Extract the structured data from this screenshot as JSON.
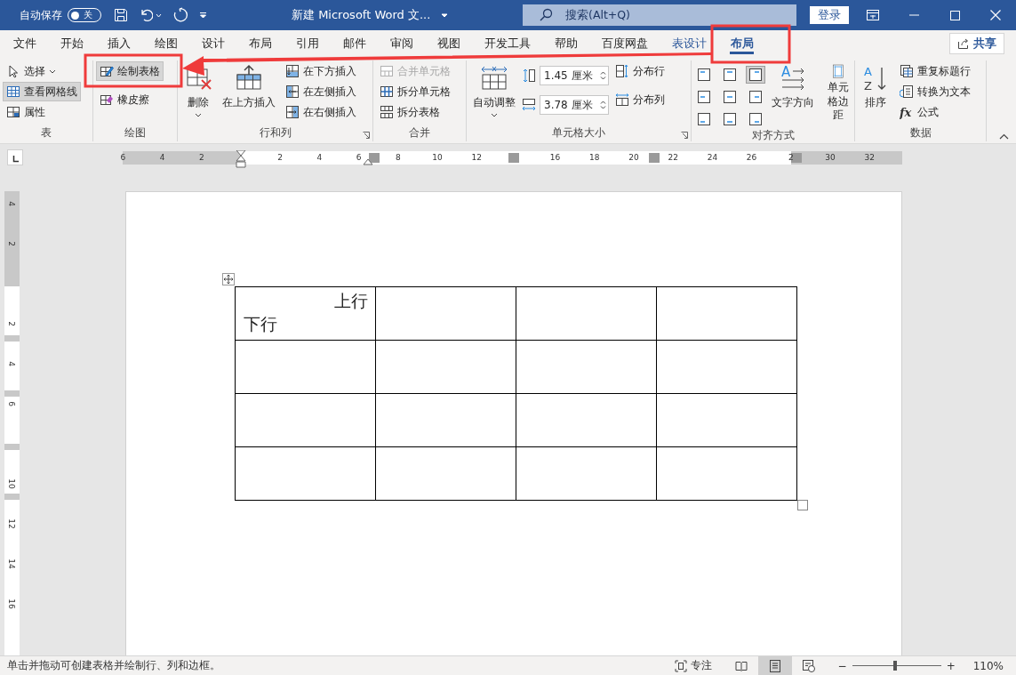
{
  "title_bar": {
    "autosave_label": "自动保存",
    "autosave": {
      "on": false,
      "label": "关"
    },
    "document_title": "新建 Microsoft Word 文...",
    "search": {
      "placeholder": "搜索(Alt+Q)"
    },
    "login": "登录"
  },
  "tabs": [
    {
      "label": "文件",
      "selected": false,
      "kind": "normal"
    },
    {
      "label": "开始",
      "selected": false,
      "kind": "normal"
    },
    {
      "label": "插入",
      "selected": false,
      "kind": "normal"
    },
    {
      "label": "绘图",
      "selected": false,
      "kind": "normal"
    },
    {
      "label": "设计",
      "selected": false,
      "kind": "normal"
    },
    {
      "label": "布局",
      "selected": false,
      "kind": "normal"
    },
    {
      "label": "引用",
      "selected": false,
      "kind": "normal"
    },
    {
      "label": "邮件",
      "selected": false,
      "kind": "normal"
    },
    {
      "label": "审阅",
      "selected": false,
      "kind": "normal"
    },
    {
      "label": "视图",
      "selected": false,
      "kind": "normal"
    },
    {
      "label": "开发工具",
      "selected": false,
      "kind": "normal"
    },
    {
      "label": "帮助",
      "selected": false,
      "kind": "normal"
    },
    {
      "label": "百度网盘",
      "selected": false,
      "kind": "normal"
    },
    {
      "label": "表设计",
      "selected": false,
      "kind": "contextual"
    },
    {
      "label": "布局",
      "selected": true,
      "kind": "contextual"
    }
  ],
  "share": "共享",
  "ribbon": [
    {
      "title": "表",
      "launcher": false,
      "columns": [
        [
          {
            "kind": "small",
            "label": "选择",
            "dropdown": true,
            "selected": false,
            "disabled": false
          },
          {
            "kind": "small",
            "label": "查看网格线",
            "dropdown": false,
            "selected": true,
            "disabled": false
          },
          {
            "kind": "small",
            "label": "属性",
            "dropdown": false,
            "selected": false,
            "disabled": false
          }
        ]
      ]
    },
    {
      "title": "绘图",
      "launcher": false,
      "columns": [
        [
          {
            "kind": "small",
            "label": "绘制表格",
            "dropdown": false,
            "selected": true,
            "disabled": false
          },
          {
            "kind": "small",
            "label": "橡皮擦",
            "dropdown": false,
            "selected": false,
            "disabled": false
          }
        ]
      ]
    },
    {
      "title": "行和列",
      "launcher": true,
      "columns": [
        [
          {
            "kind": "large",
            "label": "删除",
            "dropdown": true,
            "selected": false,
            "disabled": false
          }
        ],
        [
          {
            "kind": "large",
            "label": "在上方插入",
            "dropdown": false,
            "selected": false,
            "disabled": false
          }
        ],
        [
          {
            "kind": "small",
            "label": "在下方插入",
            "dropdown": false,
            "selected": false,
            "disabled": false
          },
          {
            "kind": "small",
            "label": "在左侧插入",
            "dropdown": false,
            "selected": false,
            "disabled": false
          },
          {
            "kind": "small",
            "label": "在右侧插入",
            "dropdown": false,
            "selected": false,
            "disabled": false
          }
        ]
      ]
    },
    {
      "title": "合并",
      "launcher": false,
      "columns": [
        [
          {
            "kind": "small",
            "label": "合并单元格",
            "dropdown": false,
            "selected": false,
            "disabled": true
          },
          {
            "kind": "small",
            "label": "拆分单元格",
            "dropdown": false,
            "selected": false,
            "disabled": false
          },
          {
            "kind": "small",
            "label": "拆分表格",
            "dropdown": false,
            "selected": false,
            "disabled": false
          }
        ]
      ]
    },
    {
      "title": "单元格大小",
      "launcher": true,
      "columns": [
        [
          {
            "kind": "large",
            "label": "自动调整",
            "dropdown": true,
            "selected": false,
            "disabled": false
          }
        ],
        [
          {
            "kind": "spin",
            "value": "1.45 厘米"
          },
          {
            "kind": "spin",
            "value": "3.78 厘米"
          }
        ],
        [
          {
            "kind": "small",
            "label": "分布行",
            "dropdown": false,
            "selected": false,
            "disabled": false
          },
          {
            "kind": "small",
            "label": "分布列",
            "dropdown": false,
            "selected": false,
            "disabled": false
          }
        ]
      ]
    },
    {
      "title": "对齐方式",
      "launcher": false,
      "columns": [
        [
          {
            "kind": "align",
            "cells": [
              {
                "selected": false
              },
              {
                "selected": false
              },
              {
                "selected": true
              },
              {
                "selected": false
              },
              {
                "selected": false
              },
              {
                "selected": false
              },
              {
                "selected": false
              },
              {
                "selected": false
              },
              {
                "selected": false
              }
            ]
          }
        ],
        [
          {
            "kind": "large",
            "label": "文字方向",
            "icon_letters": [
              "A"
            ],
            "dropdown": false,
            "selected": false,
            "disabled": false
          }
        ],
        [
          {
            "kind": "large",
            "label": "单元格边距",
            "dropdown": false,
            "selected": false,
            "disabled": false
          }
        ]
      ]
    },
    {
      "title": "数据",
      "launcher": false,
      "columns": [
        [
          {
            "kind": "large",
            "label": "排序",
            "icon_letters": [
              "A",
              "Z"
            ],
            "dropdown": false,
            "selected": false,
            "disabled": false
          }
        ],
        [
          {
            "kind": "small",
            "label": "重复标题行",
            "dropdown": false,
            "selected": false,
            "disabled": false
          },
          {
            "kind": "small",
            "label": "转换为文本",
            "dropdown": false,
            "selected": false,
            "disabled": false
          },
          {
            "kind": "small",
            "label": "公式",
            "icon_letters": [
              "fx"
            ],
            "dropdown": false,
            "selected": false,
            "disabled": false
          }
        ]
      ]
    }
  ],
  "rulers": {
    "horizontal": [
      "6",
      "4",
      "2",
      "2",
      "4",
      "6",
      "8",
      "10",
      "12",
      "16",
      "18",
      "20",
      "22",
      "24",
      "26",
      "2",
      "30",
      "32"
    ],
    "vertical": [
      "4",
      "2",
      "2",
      "4",
      "6",
      "10",
      "12",
      "14",
      "16"
    ]
  },
  "document": {
    "table": {
      "rows": [
        [
          {
            "top": "上行",
            "bottom": "下行"
          },
          {},
          {},
          {}
        ],
        [
          {},
          {},
          {},
          {}
        ],
        [
          {},
          {},
          {},
          {}
        ],
        [
          {},
          {},
          {},
          {}
        ]
      ]
    }
  },
  "status_bar": {
    "message": "单击并拖动可创建表格并绘制行、列和边框。",
    "focus": "专注",
    "views": [
      {
        "selected": false
      },
      {
        "selected": true
      },
      {
        "selected": false
      }
    ],
    "zoom": {
      "minus": "−",
      "plus": "+",
      "level": 0.48,
      "percent": "110%"
    }
  }
}
